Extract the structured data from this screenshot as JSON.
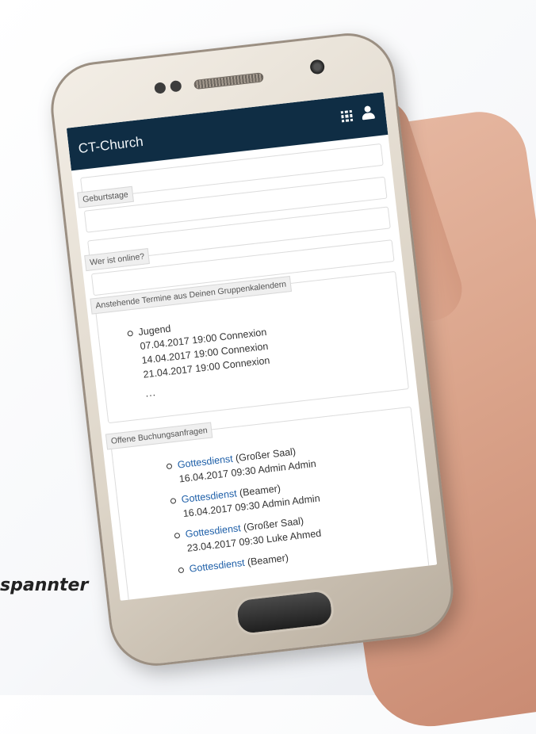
{
  "caption": "spannter",
  "topbar": {
    "brand": "CT-Church"
  },
  "panels": {
    "birthdays": {
      "title": "Geburtstage"
    },
    "online": {
      "title": "Wer ist online?"
    },
    "calendar": {
      "title": "Anstehende Termine aus Deinen Gruppenkalendern",
      "group": "Jugend",
      "events": [
        "07.04.2017 19:00 Connexion",
        "14.04.2017 19:00 Connexion",
        "21.04.2017 19:00 Connexion"
      ],
      "more": "..."
    },
    "bookings": {
      "title": "Offene Buchungsanfragen",
      "items": [
        {
          "link": "Gottesdienst",
          "resource": "(Großer Saal)",
          "detail": "16.04.2017 09:30 Admin Admin"
        },
        {
          "link": "Gottesdienst",
          "resource": "(Beamer)",
          "detail": "16.04.2017 09:30 Admin Admin"
        },
        {
          "link": "Gottesdienst",
          "resource": "(Großer Saal)",
          "detail": "23.04.2017 09:30 Luke Ahmed"
        },
        {
          "link": "Gottesdienst",
          "resource": "(Beamer)",
          "detail": ""
        }
      ]
    }
  },
  "icons": [
    "apps-grid-icon",
    "user-icon"
  ],
  "colors": {
    "topbar": "#0f2d44",
    "link": "#1e5fa8"
  }
}
